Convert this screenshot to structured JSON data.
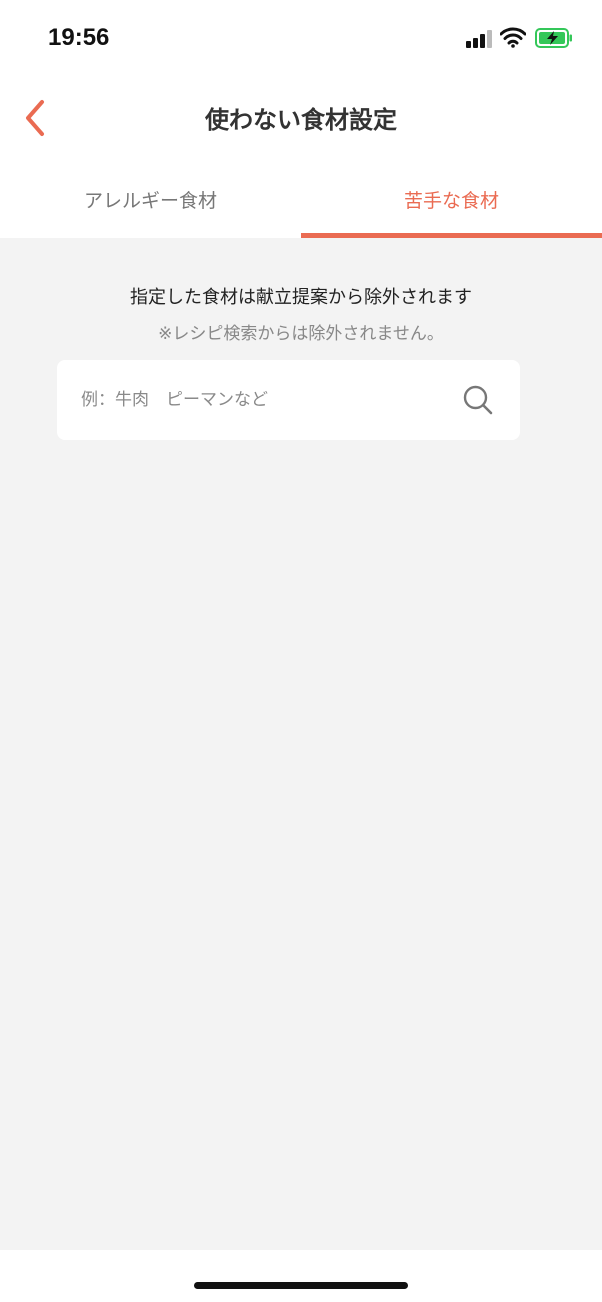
{
  "status_bar": {
    "time": "19:56",
    "icons": [
      "cellular-signal-icon",
      "wifi-icon",
      "battery-charging-icon"
    ],
    "battery_color": "#34c759"
  },
  "nav": {
    "back_icon": "chevron-left-icon",
    "title": "使わない食材設定"
  },
  "tabs": [
    {
      "label": "アレルギー食材",
      "active": false
    },
    {
      "label": "苦手な食材",
      "active": true
    }
  ],
  "info": {
    "main": "指定した食材は献立提案から除外されます",
    "sub": "※レシピ検索からは除外されません。"
  },
  "search": {
    "placeholder": "例：牛肉　ピーマンなど",
    "value": "",
    "icon": "search-icon"
  },
  "colors": {
    "accent": "#ea6b52",
    "background": "#f3f3f3"
  }
}
